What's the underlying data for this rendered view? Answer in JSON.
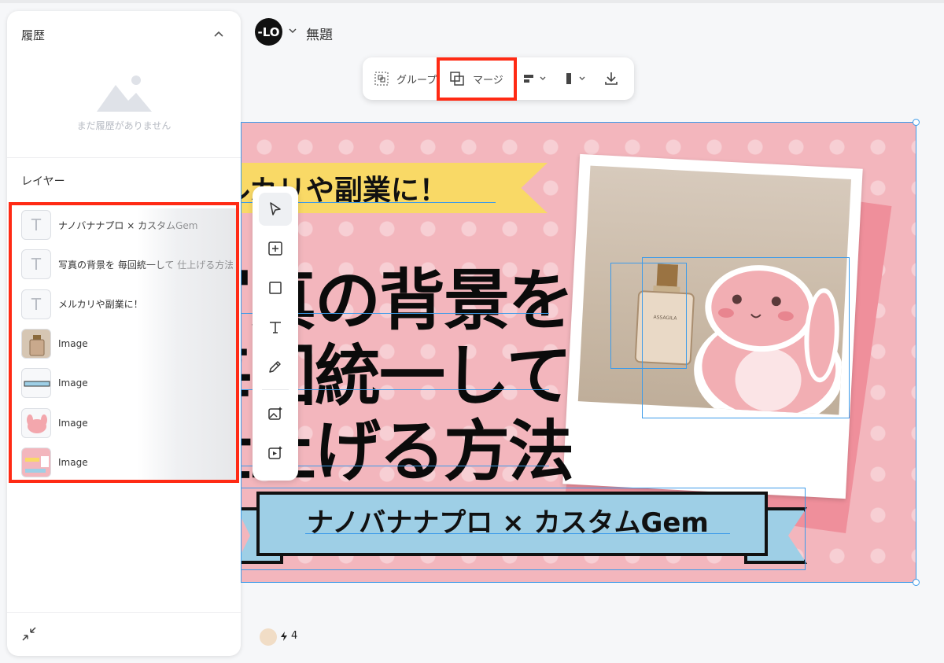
{
  "header": {
    "logo_text": "-LO",
    "title": "無題"
  },
  "history_panel": {
    "title": "履歴",
    "empty_message": "まだ履歴がありません"
  },
  "layers_panel": {
    "title": "レイヤー",
    "items": [
      {
        "type": "text",
        "label": "ナノバナナプロ × カスタムGem"
      },
      {
        "type": "text",
        "label": "写真の背景を 毎回統一して 仕上げる方法"
      },
      {
        "type": "text",
        "label": "メルカリや副業に！"
      },
      {
        "type": "image",
        "label": "Image"
      },
      {
        "type": "image",
        "label": "Image"
      },
      {
        "type": "image",
        "label": "Image"
      },
      {
        "type": "image",
        "label": "Image"
      }
    ]
  },
  "toolbar": {
    "group_label": "グループ",
    "merge_label": "マージ"
  },
  "canvas": {
    "banner_top": "メルカリや副業に！",
    "headline_lines": [
      "写真の背景を",
      "毎回統一して",
      "仕上げる方法"
    ],
    "banner_bottom": "ナノバナナプロ × カスタムGem",
    "bottle_label": "ASSAGILA"
  },
  "status": {
    "credits": "4"
  },
  "colors": {
    "highlight_red": "#ff2a14",
    "selection_blue": "#3d9be9",
    "canvas_pink": "#f3b6bd"
  }
}
